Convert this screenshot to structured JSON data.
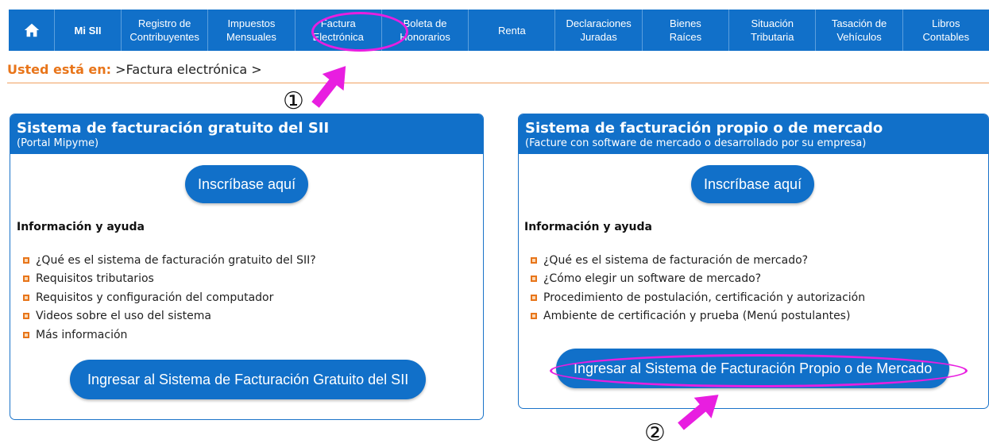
{
  "nav": {
    "home_icon": "home-icon",
    "items": [
      {
        "label": "Mi SII"
      },
      {
        "label": "Registro de\nContribuyentes"
      },
      {
        "label": "Impuestos\nMensuales"
      },
      {
        "label": "Factura\nElectrónica"
      },
      {
        "label": "Boleta de\nHonorarios"
      },
      {
        "label": "Renta"
      },
      {
        "label": "Declaraciones\nJuradas"
      },
      {
        "label": "Bienes\nRaíces"
      },
      {
        "label": "Situación\nTributaria"
      },
      {
        "label": "Tasación de\nVehículos"
      },
      {
        "label": "Libros\nContables"
      }
    ]
  },
  "breadcrumb": {
    "label": "Usted está en:",
    "items": [
      ">Factura electrónica >"
    ]
  },
  "left_panel": {
    "title": "Sistema de facturación gratuito del SII",
    "subtitle": "(Portal Mipyme)",
    "signup_label": "Inscríbase aquí",
    "info_heading": "Información y ayuda",
    "links": [
      "¿Qué es el sistema de facturación gratuito del SII?",
      "Requisitos tributarios",
      "Requisitos y configuración del computador",
      "Videos sobre el uso del sistema",
      "Más información"
    ],
    "enter_label": "Ingresar al Sistema de Facturación Gratuito del SII"
  },
  "right_panel": {
    "title": "Sistema de facturación propio o de mercado",
    "subtitle": "(Facture con software de mercado o desarrollado por su empresa)",
    "signup_label": "Inscríbase aquí",
    "info_heading": "Información y ayuda",
    "links": [
      "¿Qué es el sistema de facturación de mercado?",
      "¿Cómo elegir un software de mercado?",
      "Procedimiento de postulación, certificación y autorización",
      "Ambiente de certificación y prueba (Menú postulantes)"
    ],
    "enter_label": "Ingresar al Sistema de Facturación Propio o de Mercado"
  },
  "annotations": {
    "step1": "①",
    "step2": "②",
    "highlight_color": "#e81ee0"
  },
  "colors": {
    "primary": "#1170c9",
    "accent": "#e8751a"
  }
}
